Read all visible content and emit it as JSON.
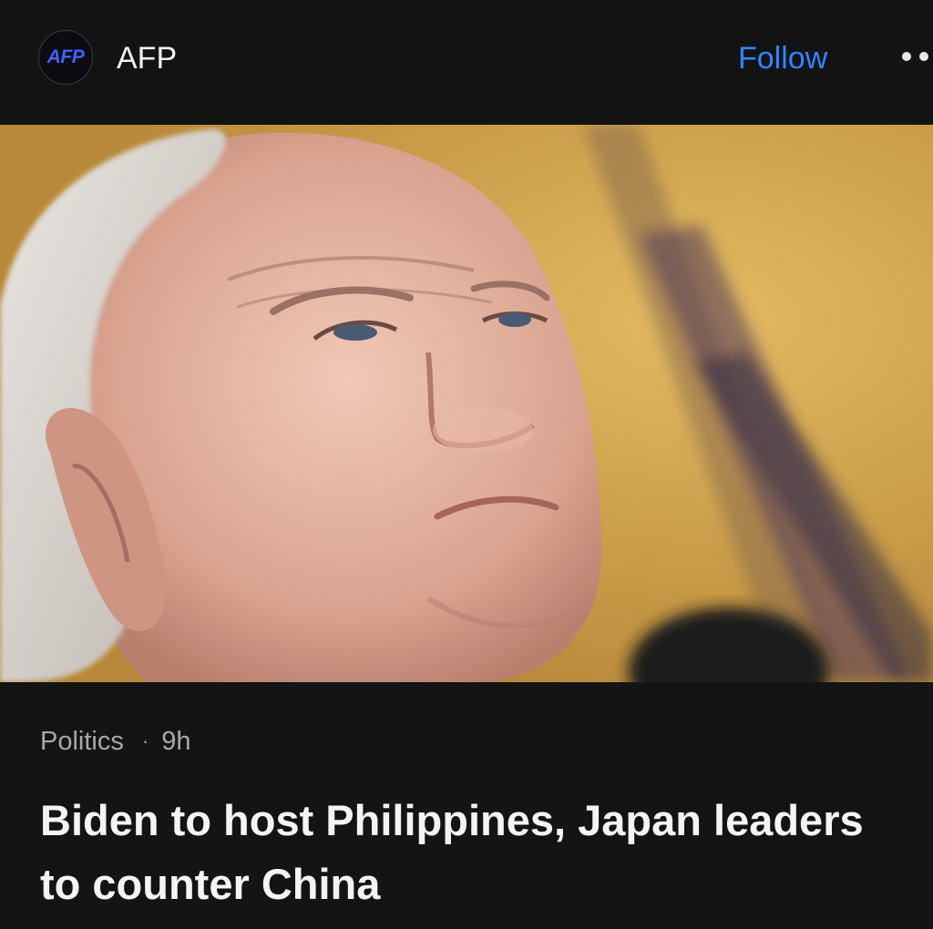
{
  "header": {
    "logo_text": "AFP",
    "source_name": "AFP",
    "follow_label": "Follow",
    "more_icon": "more-dots-icon"
  },
  "article": {
    "image_description_icon": "article-photo",
    "category": "Politics",
    "separator": "·",
    "age": "9h",
    "headline_line1": "Biden to host Philippines, Japan leaders",
    "headline_line2": "to counter China"
  },
  "colors": {
    "background": "#141414",
    "accent": "#2f86ff",
    "logo": "#3d63ff"
  }
}
